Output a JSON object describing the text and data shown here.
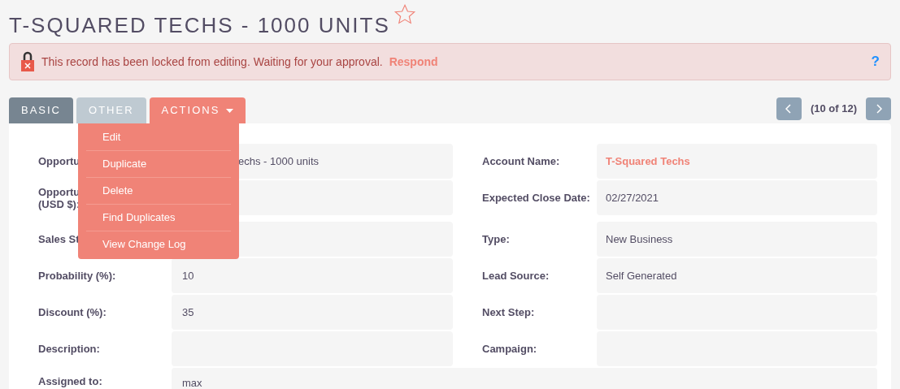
{
  "title": "T-SQUARED TECHS - 1000 UNITS",
  "favorite": {
    "on": false
  },
  "alert": {
    "message": "This record has been locked from editing. Waiting for your approval.",
    "link": "Respond",
    "help": "?"
  },
  "tabs": [
    {
      "label": "BASIC",
      "selected": true,
      "kind": "tab"
    },
    {
      "label": "OTHER",
      "selected": false,
      "kind": "tab"
    },
    {
      "label": "ACTIONS",
      "kind": "menu"
    }
  ],
  "actions_menu": {
    "items": [
      "Edit",
      "Duplicate",
      "Delete",
      "Find Duplicates",
      "View Change Log"
    ]
  },
  "pager": {
    "text": "(10 of 12)"
  },
  "sections": [
    [
      {
        "left": {
          "label": "Opportu",
          "value": "echs - 1000 units",
          "covered": true
        },
        "right": {
          "label": "Account Name:",
          "value": "T-Squared Techs",
          "kind": "link"
        }
      },
      {
        "left": {
          "label": "Opportu\n(USD $):"
        },
        "right": {
          "label": "Expected Close Date:",
          "value": "02/27/2021",
          "kind": "text"
        }
      }
    ],
    [
      {
        "left": {
          "label": "Sales St"
        },
        "right": {
          "label": "Type:",
          "value": "New Business",
          "kind": "text"
        }
      },
      {
        "left": {
          "label": "Probability (%):",
          "value": "10"
        },
        "right": {
          "label": "Lead Source:",
          "value": "Self Generated",
          "kind": "text"
        }
      },
      {
        "left": {
          "label": "Discount (%):",
          "value": "35"
        },
        "right": {
          "label": "Next Step:"
        }
      },
      {
        "left": {
          "label": "Description:"
        },
        "right": {
          "label": "Campaign:"
        }
      }
    ]
  ],
  "assigned": {
    "label": "Assigned to:",
    "value": "max"
  }
}
